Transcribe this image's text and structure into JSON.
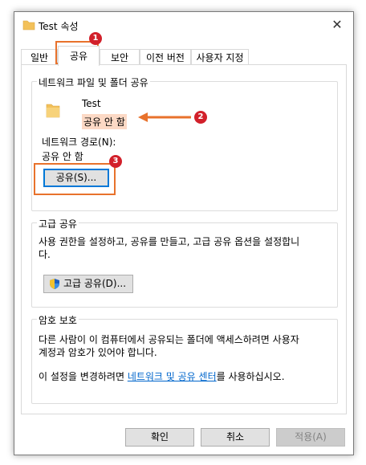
{
  "window": {
    "title": "Test 속성",
    "close_glyph": "✕"
  },
  "tabs": [
    {
      "label": "일반"
    },
    {
      "label": "공유",
      "active": true
    },
    {
      "label": "보안"
    },
    {
      "label": "이전 버전"
    },
    {
      "label": "사용자 지정"
    }
  ],
  "network_share": {
    "group_title": "네트워크 파일 및 폴더 공유",
    "folder_name": "Test",
    "share_state": "공유 안 함",
    "path_label": "네트워크 경로(N):",
    "path_value": "공유 안 함",
    "share_button": "공유(S)..."
  },
  "advanced_share": {
    "group_title": "고급 공유",
    "description_line1": "사용 권한을 설정하고, 공유를 만들고, 고급 공유 옵션을 설정합니",
    "description_line2": "다.",
    "button": "고급 공유(D)..."
  },
  "password": {
    "group_title": "암호 보호",
    "line1": "다른 사람이 이 컴퓨터에서 공유되는 폴더에 액세스하려면 사용자",
    "line2": "계정과 암호가 있어야 합니다.",
    "line3_prefix": "이 설정을 변경하려면 ",
    "link_text": "네트워크 및 공유 센터",
    "line3_suffix": "를 사용하십시오."
  },
  "footer": {
    "ok": "확인",
    "cancel": "취소",
    "apply": "적용(A)"
  },
  "annotations": {
    "badge1": "1",
    "badge2": "2",
    "badge3": "3"
  },
  "colors": {
    "annotation": "#e8722c",
    "badge": "#d2202a",
    "link": "#0066cc",
    "focus": "#0078d7",
    "folder": "#f3c15a"
  }
}
